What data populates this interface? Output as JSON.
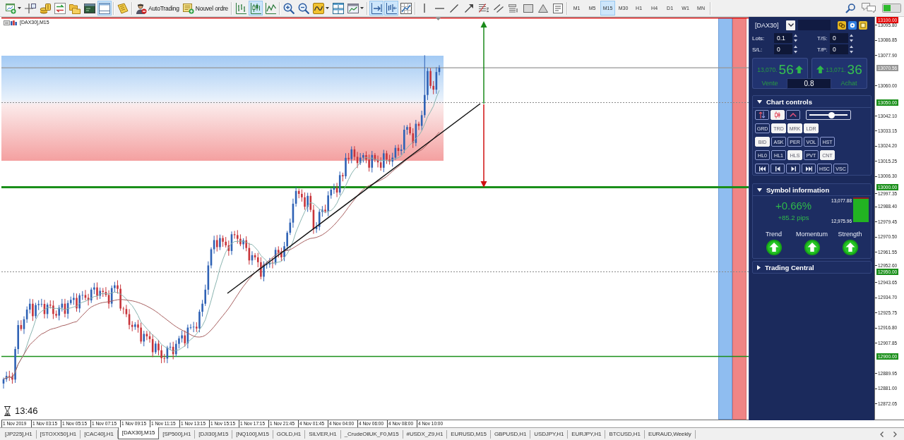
{
  "toolbar": {
    "groups": [
      [
        {
          "kind": "icon",
          "pressed": false,
          "dropdown": true
        },
        {
          "kind": "icon",
          "pressed": false
        },
        {
          "kind": "icon",
          "pressed": false
        },
        {
          "kind": "icon",
          "pressed": false
        },
        {
          "kind": "icon",
          "pressed": false
        },
        {
          "kind": "icon",
          "pressed": false
        },
        {
          "kind": "icon",
          "pressed": true
        }
      ],
      [
        {
          "kind": "icon",
          "pressed": false
        }
      ],
      [
        {
          "kind": "labeled",
          "label": "AutoTrading",
          "pressed": false
        },
        {
          "kind": "labeled",
          "label": "Nouvel ordre",
          "pressed": false
        }
      ],
      [
        {
          "kind": "icon",
          "pressed": false
        },
        {
          "kind": "icon",
          "pressed": true
        },
        {
          "kind": "icon",
          "pressed": false
        }
      ],
      [
        {
          "kind": "icon",
          "pressed": false
        },
        {
          "kind": "icon",
          "pressed": false
        },
        {
          "kind": "icon",
          "pressed": false,
          "dropdown": true
        },
        {
          "kind": "icon",
          "pressed": false
        },
        {
          "kind": "icon",
          "pressed": false,
          "dropdown": true
        }
      ],
      [
        {
          "kind": "icon",
          "pressed": true
        },
        {
          "kind": "icon",
          "pressed": true
        },
        {
          "kind": "icon",
          "pressed": false
        }
      ],
      [
        {
          "kind": "icon",
          "pressed": false
        },
        {
          "kind": "icon",
          "pressed": false
        },
        {
          "kind": "icon",
          "pressed": false
        },
        {
          "kind": "icon",
          "pressed": false
        },
        {
          "kind": "icon",
          "pressed": false
        },
        {
          "kind": "icon",
          "pressed": false
        },
        {
          "kind": "icon",
          "pressed": false
        },
        {
          "kind": "icon",
          "pressed": false
        },
        {
          "kind": "icon",
          "pressed": false
        },
        {
          "kind": "icon",
          "pressed": false
        }
      ]
    ],
    "timeframes": [
      {
        "label": "M1",
        "selected": false
      },
      {
        "label": "M5",
        "selected": false
      },
      {
        "label": "M15",
        "selected": true
      },
      {
        "label": "M30",
        "selected": false
      },
      {
        "label": "H1",
        "selected": false
      },
      {
        "label": "H4",
        "selected": false
      },
      {
        "label": "D1",
        "selected": false
      },
      {
        "label": "W1",
        "selected": false
      },
      {
        "label": "MN",
        "selected": false
      }
    ]
  },
  "chart": {
    "symbol_label": "[DAX30],M15",
    "countdown": "13:46"
  },
  "trade_panel": {
    "symbol": "[DAX30]",
    "order_fields": [
      {
        "label": "Lots:",
        "value": "0.1"
      },
      {
        "label": "T/S:",
        "value": "0"
      },
      {
        "label": "S/L:",
        "value": "0"
      },
      {
        "label": "T/P:",
        "value": "0"
      }
    ],
    "sell": {
      "price_small": "13,070.",
      "price_large": "56",
      "label": "Vente",
      "rising": true
    },
    "buy": {
      "price_small": "13,071.",
      "price_large": "36",
      "label": "Achat",
      "rising": true
    },
    "spread": "0.8",
    "chart_controls": {
      "title": "Chart controls",
      "expanded": true,
      "rows": [
        [
          {
            "kind": "icon",
            "on": false
          },
          {
            "kind": "icon",
            "on": true
          },
          {
            "kind": "icon",
            "on": false
          },
          {
            "kind": "slider",
            "level": 0.58
          }
        ],
        [
          {
            "kind": "text",
            "label": "GRD",
            "on": false
          },
          {
            "kind": "text",
            "label": "TRD",
            "on": true
          },
          {
            "kind": "text",
            "label": "MRK",
            "on": true
          },
          {
            "kind": "text",
            "label": "LDR",
            "on": true
          }
        ],
        [
          {
            "kind": "text",
            "label": "BID",
            "on": true
          },
          {
            "kind": "text",
            "label": "ASK",
            "on": false
          },
          {
            "kind": "text",
            "label": "PER",
            "on": false
          },
          {
            "kind": "text",
            "label": "VOL",
            "on": false
          },
          {
            "kind": "text",
            "label": "HST",
            "on": false
          }
        ],
        [
          {
            "kind": "text",
            "label": "HL0",
            "on": false
          },
          {
            "kind": "text",
            "label": "HL1",
            "on": false
          },
          {
            "kind": "text",
            "label": "HLS",
            "on": true
          },
          {
            "kind": "text",
            "label": "PVT",
            "on": false
          },
          {
            "kind": "text",
            "label": "CNT",
            "on": true
          }
        ],
        [
          {
            "kind": "icon",
            "on": false
          },
          {
            "kind": "icon",
            "on": false
          },
          {
            "kind": "icon",
            "on": false
          },
          {
            "kind": "icon",
            "on": false
          },
          {
            "kind": "text",
            "label": "HSC",
            "on": false
          },
          {
            "kind": "text",
            "label": "VSC",
            "on": false
          }
        ]
      ]
    },
    "symbol_information": {
      "title": "Symbol information",
      "expanded": true,
      "change_percent": "+0.66%",
      "change_pips": "+85.2 pips",
      "high": "13,077.88",
      "low": "12,975.96",
      "range": {
        "level": 0.93
      },
      "signals": [
        {
          "label": "Trend",
          "rising": true
        },
        {
          "label": "Momentum",
          "rising": true
        },
        {
          "label": "Strength",
          "rising": true
        }
      ]
    },
    "trading_central": {
      "title": "Trading Central",
      "expanded": false
    }
  },
  "price_axis": {
    "ticks": [
      "13095.80",
      "13086.85",
      "13077.90",
      "13060.00",
      "13042.10",
      "13033.15",
      "13024.20",
      "13015.25",
      "13006.30",
      "12997.35",
      "12988.40",
      "12979.45",
      "12970.50",
      "12961.55",
      "12952.60",
      "12943.65",
      "12934.70",
      "12925.75",
      "12916.80",
      "12907.85",
      "12889.95",
      "12881.00",
      "12872.05"
    ],
    "markers": [
      {
        "label": "13100.00",
        "color": "#e00000",
        "kind": "solid"
      },
      {
        "label": "13070.56",
        "color": "#969696",
        "kind": "solid"
      },
      {
        "label": "13050.00",
        "color": "#1a8f1a",
        "kind": "dotted"
      },
      {
        "label": "13000.00",
        "color": "#1a8f1a",
        "kind": "thick"
      },
      {
        "label": "12950.00",
        "color": "#1a8f1a",
        "kind": "dotted"
      },
      {
        "label": "12900.00",
        "color": "#1a8f1a",
        "kind": "solid"
      }
    ]
  },
  "time_axis": {
    "labels": [
      "1 Nov 2019",
      "1 Nov 03:15",
      "1 Nov 05:15",
      "1 Nov 07:15",
      "1 Nov 09:15",
      "1 Nov 11:15",
      "1 Nov 13:15",
      "1 Nov 15:15",
      "1 Nov 17:15",
      "1 Nov 21:45",
      "4 Nov 01:45",
      "4 Nov 04:00",
      "4 Nov 06:00",
      "4 Nov 08:00",
      "4 Nov 10:00"
    ]
  },
  "symbol_tabs": [
    {
      "label": "[JP225],H1",
      "selected": false
    },
    {
      "label": "[STOXX50],H1",
      "selected": false
    },
    {
      "label": "[CAC40],H1",
      "selected": false
    },
    {
      "label": "[DAX30],M15",
      "selected": true
    },
    {
      "label": "[SP500],H1",
      "selected": false
    },
    {
      "label": "[DJI30],M15",
      "selected": false
    },
    {
      "label": "[NQ100],M15",
      "selected": false
    },
    {
      "label": "GOLD,H1",
      "selected": false
    },
    {
      "label": "SILVER,H1",
      "selected": false
    },
    {
      "label": "_CrudeOilUK_F0,M15",
      "selected": false
    },
    {
      "label": "#USDX_Z9,H1",
      "selected": false
    },
    {
      "label": "EURUSD,M15",
      "selected": false
    },
    {
      "label": "GBPUSD,H1",
      "selected": false
    },
    {
      "label": "USDJPY,H1",
      "selected": false
    },
    {
      "label": "EURJPY,H1",
      "selected": false
    },
    {
      "label": "BTCUSD,H1",
      "selected": false
    },
    {
      "label": "EURAUD,Weekly",
      "selected": false
    }
  ]
}
